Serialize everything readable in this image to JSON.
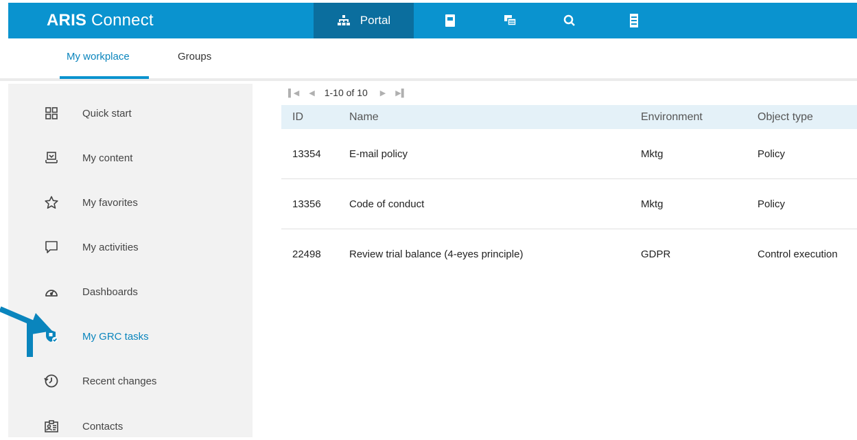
{
  "app": {
    "brand_bold": "ARIS",
    "brand_rest": " Connect",
    "accent": "#0a93cf",
    "accent_dark": "#0b6e9e"
  },
  "topnav": {
    "portal_label": "Portal",
    "icons": [
      "sitemap-icon",
      "book-icon",
      "chat-icon",
      "search-icon",
      "document-icon"
    ]
  },
  "subtabs": [
    {
      "label": "My workplace",
      "active": true
    },
    {
      "label": "Groups",
      "active": false
    }
  ],
  "sidebar": {
    "items": [
      {
        "label": "Quick start",
        "icon": "grid-icon"
      },
      {
        "label": "My content",
        "icon": "inbox-icon"
      },
      {
        "label": "My favorites",
        "icon": "star-icon"
      },
      {
        "label": "My activities",
        "icon": "speech-bubble-icon"
      },
      {
        "label": "Dashboards",
        "icon": "gauge-icon"
      },
      {
        "label": "My GRC tasks",
        "icon": "shield-check-icon",
        "active": true
      },
      {
        "label": "Recent changes",
        "icon": "history-icon"
      },
      {
        "label": "Contacts",
        "icon": "contact-card-icon"
      }
    ]
  },
  "pager": {
    "range": "1-10 of 10"
  },
  "table": {
    "headers": {
      "id": "ID",
      "name": "Name",
      "environment": "Environment",
      "object_type": "Object type"
    },
    "rows": [
      {
        "id": "13354",
        "name": "E-mail policy",
        "environment": "Mktg",
        "object_type": "Policy"
      },
      {
        "id": "13356",
        "name": "Code of conduct",
        "environment": "Mktg",
        "object_type": "Policy"
      },
      {
        "id": "22498",
        "name": "Review trial balance (4-eyes principle)",
        "environment": "GDPR",
        "object_type": "Control execution"
      }
    ]
  }
}
